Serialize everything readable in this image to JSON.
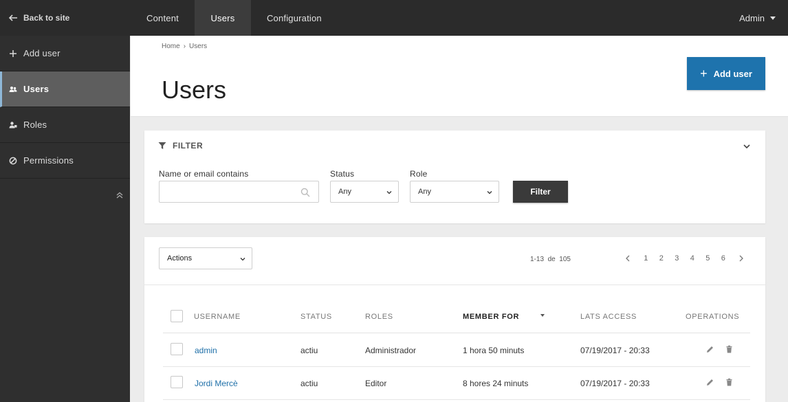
{
  "topbar": {
    "back_label": "Back to site",
    "tabs": [
      {
        "label": "Content"
      },
      {
        "label": "Users"
      },
      {
        "label": "Configuration"
      }
    ],
    "admin_label": "Admin"
  },
  "sidebar": {
    "items": [
      {
        "label": "Add user",
        "icon": "plus-icon"
      },
      {
        "label": "Users",
        "icon": "users-icon"
      },
      {
        "label": "Roles",
        "icon": "roles-icon"
      },
      {
        "label": "Permissions",
        "icon": "permissions-icon"
      }
    ]
  },
  "header": {
    "breadcrumb": [
      "Home",
      "Users"
    ],
    "breadcrumb_separator": "›",
    "title": "Users",
    "add_user_label": "Add user",
    "add_user_color": "#1e73ad"
  },
  "filter": {
    "heading": "FILTER",
    "name_label": "Name or email contains",
    "name_value": "",
    "status_label": "Status",
    "status_value": "Any",
    "role_label": "Role",
    "role_value": "Any",
    "button_label": "Filter"
  },
  "list": {
    "actions_label": "Actions",
    "range": "1-13",
    "range_of": "de",
    "total": "105",
    "pages": [
      "1",
      "2",
      "3",
      "4",
      "5",
      "6"
    ],
    "columns": [
      "USERNAME",
      "STATUS",
      "ROLES",
      "MEMBER FOR",
      "LATS ACCESS",
      "OPERATIONS"
    ],
    "sorted_column": "MEMBER FOR",
    "rows": [
      {
        "username": "admin",
        "status": "actiu",
        "roles": "Administrador",
        "member_for": "1 hora 50 minuts",
        "last_access": "07/19/2017 - 20:33"
      },
      {
        "username": "Jordi Mercè",
        "status": "actiu",
        "roles": "Editor",
        "member_for": "8 hores 24 minuts",
        "last_access": "07/19/2017 - 20:33"
      }
    ]
  }
}
